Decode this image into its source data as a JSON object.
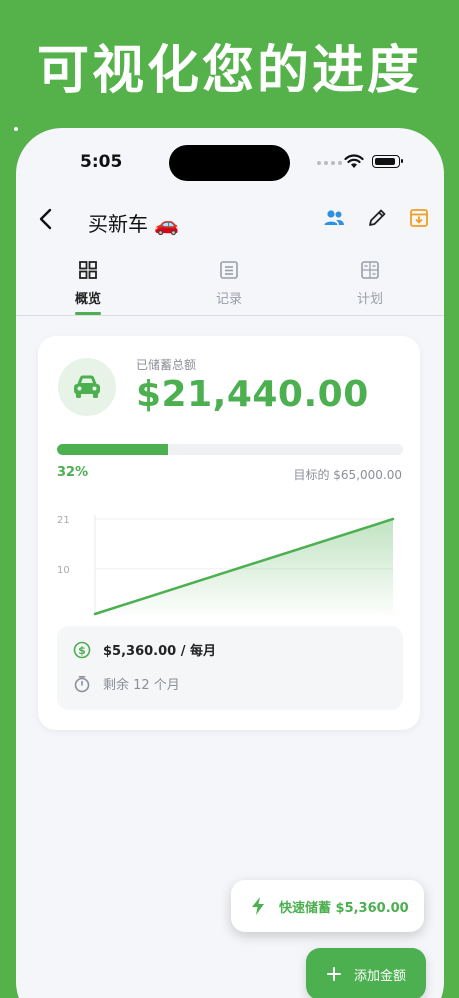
{
  "promo": {
    "headline": "可视化您的进度"
  },
  "status_bar": {
    "time": "5:05"
  },
  "nav": {
    "title": "买新车 🚗"
  },
  "tabs": [
    {
      "label": "概览",
      "icon": "grid-icon",
      "active": true
    },
    {
      "label": "记录",
      "icon": "list-icon",
      "active": false
    },
    {
      "label": "计划",
      "icon": "calculator-icon",
      "active": false
    }
  ],
  "summary": {
    "saved_label": "已储蓄总额",
    "saved_amount": "$21,440.00",
    "progress_percent": 32,
    "progress_label": "32%",
    "target_label": "目标的 $65,000.00"
  },
  "chart_data": {
    "type": "area",
    "y_ticks": [
      "21",
      "10"
    ],
    "ylim": [
      0,
      21
    ],
    "series": [
      {
        "values": [
          0,
          21
        ]
      }
    ],
    "grid": true,
    "color": "#4caf50"
  },
  "plan": {
    "monthly": "$5,360.00 / 每月",
    "remaining": "剩余 12 个月"
  },
  "actions": {
    "quick_save": "快速储蓄 $5,360.00",
    "add_amount": "添加金额"
  },
  "colors": {
    "accent": "#4caf50",
    "background": "#55b14a",
    "icon_blue": "#2f8fe0",
    "icon_orange": "#f0a020"
  }
}
